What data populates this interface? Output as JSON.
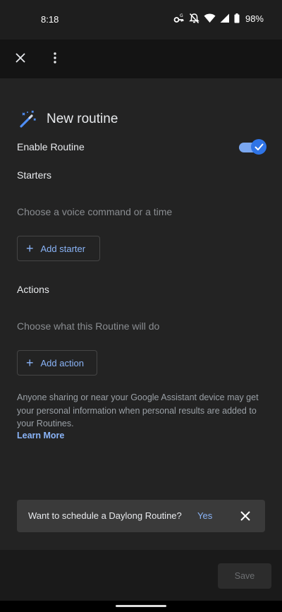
{
  "status_bar": {
    "time": "8:18",
    "battery": "98%",
    "icons": [
      "key-g-icon",
      "bell-off-icon",
      "wifi-icon",
      "signal-icon",
      "battery-icon"
    ]
  },
  "app_bar": {
    "close_icon": "close-icon",
    "menu_icon": "more-vert-icon"
  },
  "routine": {
    "title": "New routine",
    "title_icon": "magic-wand-icon",
    "enable_label": "Enable Routine",
    "enabled": true
  },
  "starters": {
    "heading": "Starters",
    "hint": "Choose a voice command or a time",
    "add_label": "Add starter"
  },
  "actions": {
    "heading": "Actions",
    "hint": "Choose what this Routine will do",
    "add_label": "Add action"
  },
  "disclaimer": {
    "text": "Anyone sharing or near your Google Assistant device may get your personal information when personal results are added to your Routines.",
    "link": "Learn More"
  },
  "snackbar": {
    "message": "Want to schedule a Daylong Routine?",
    "action": "Yes"
  },
  "footer": {
    "save_label": "Save"
  },
  "colors": {
    "accent": "#8ab4f8",
    "toggle_on": "#2f74e6",
    "background": "#232323"
  }
}
